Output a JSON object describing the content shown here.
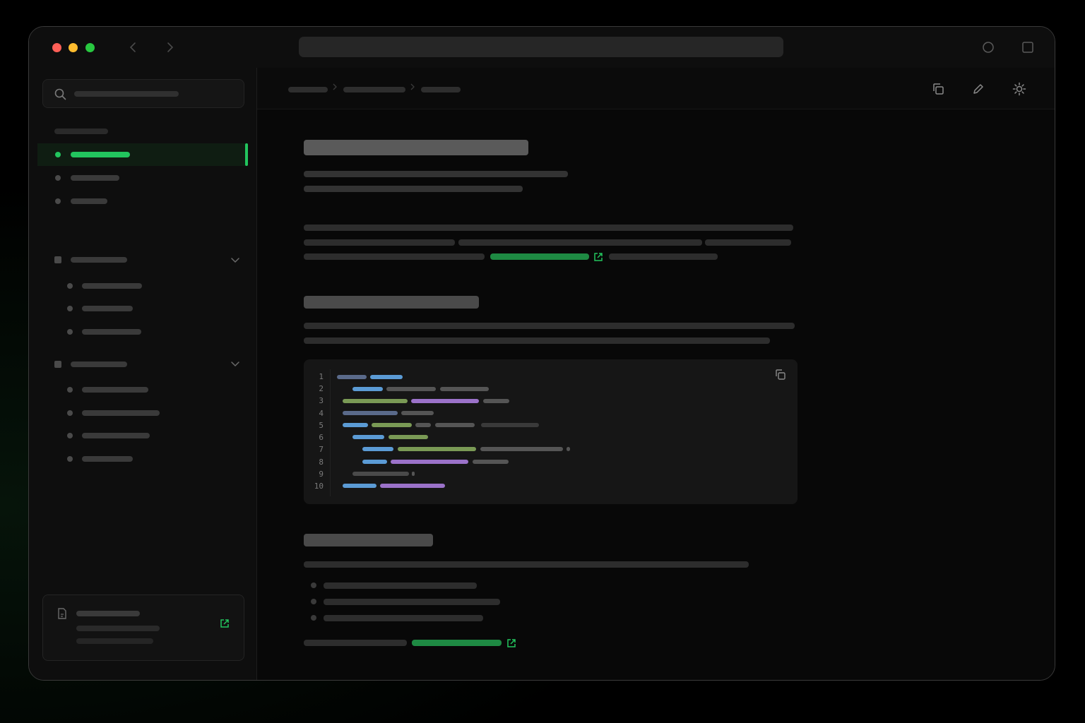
{
  "window": {
    "traffic_lights": {
      "close": "#ff5f57",
      "minimize": "#febc2e",
      "maximize": "#28c840"
    },
    "url": ""
  },
  "sidebar": {
    "search_placeholder": "",
    "accent": "#22c55e",
    "groups": [
      {
        "type": "top",
        "items": [
          "",
          "",
          ""
        ],
        "active_index": 0
      },
      {
        "type": "collapsible",
        "expanded": true,
        "children": [
          "",
          "",
          ""
        ]
      },
      {
        "type": "collapsible",
        "expanded": true,
        "children": [
          "",
          "",
          "",
          ""
        ]
      }
    ],
    "footer_card": {
      "icon": "document-icon",
      "action_icon": "external-link-icon"
    }
  },
  "main": {
    "breadcrumb": [
      "",
      "",
      ""
    ],
    "toolbar_icons": [
      "copy-icon",
      "pencil-icon",
      "sun-icon"
    ],
    "code_block": {
      "line_numbers": [
        "1",
        "2",
        "3",
        "4",
        "5",
        "6",
        "7",
        "8",
        "9",
        "10"
      ],
      "copy_icon": "copy-icon"
    },
    "link_color": "#22c55e"
  }
}
